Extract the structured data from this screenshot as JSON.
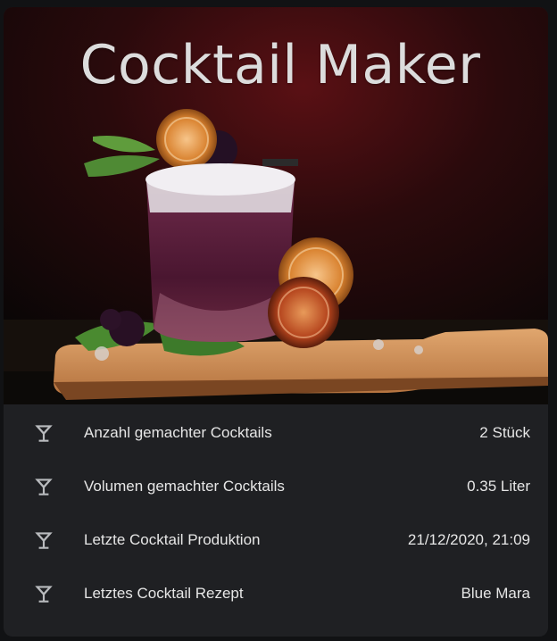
{
  "header": {
    "title": "Cocktail Maker"
  },
  "entities": [
    {
      "icon": "glass-cocktail-icon",
      "label": "Anzahl gemachter Cocktails",
      "value": "2 Stück"
    },
    {
      "icon": "glass-cocktail-icon",
      "label": "Volumen gemachter Cocktails",
      "value": "0.35 Liter"
    },
    {
      "icon": "glass-cocktail-icon",
      "label": "Letzte Cocktail Produktion",
      "value": "21/12/2020, 21:09"
    },
    {
      "icon": "glass-cocktail-icon",
      "label": "Letztes Cocktail Rezept",
      "value": "Blue Mara"
    }
  ],
  "colors": {
    "card_background": "#1f2023",
    "text": "#e6e6e6",
    "icon": "#b9bbbe"
  }
}
